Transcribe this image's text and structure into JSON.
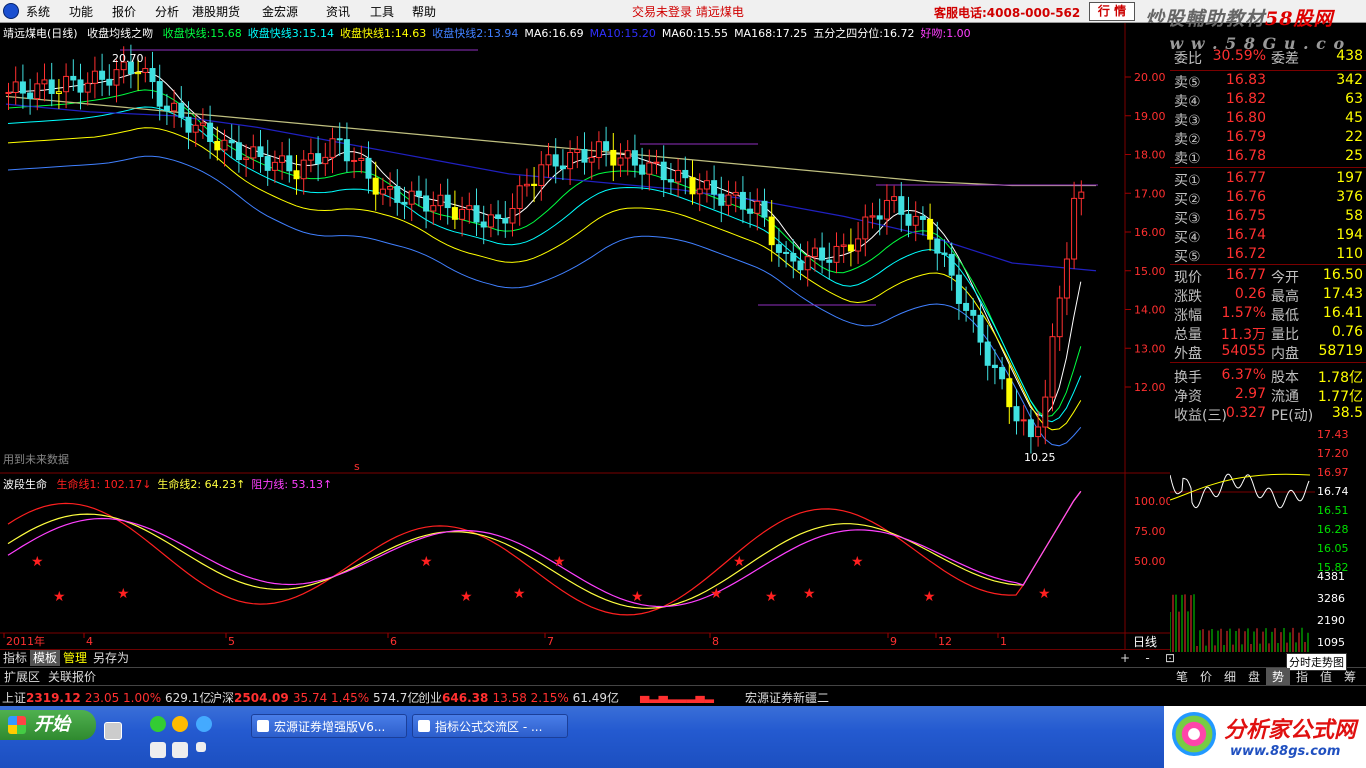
{
  "menu": {
    "items": [
      "系统",
      "功能",
      "报价",
      "分析",
      "港股期货",
      "金宏源",
      "资讯",
      "工具",
      "帮助"
    ],
    "notice": "交易未登录  靖远煤电",
    "phone": "客服电话:4008-000-562",
    "quote_button": "行 情",
    "watermark1": "炒股輔助教材",
    "watermark1_site": "58股网",
    "watermark2": "w w w . 5 8 G u . c o m"
  },
  "main_chart": {
    "title": "靖远煤电(日线)",
    "indicator": "收盘均线之吻",
    "lines": [
      {
        "label": "收盘快线:",
        "value": "15.68",
        "color": "#00ff40"
      },
      {
        "label": "收盘快线3:",
        "value": "15.14",
        "color": "#00ffff"
      },
      {
        "label": "收盘快线1:",
        "value": "14.63",
        "color": "#ffff00"
      },
      {
        "label": "收盘快线2:",
        "value": "13.94",
        "color": "#4080ff"
      },
      {
        "label": "MA6:",
        "value": "16.69",
        "color": "#ffffff"
      },
      {
        "label": "MA10:",
        "value": "15.20",
        "color": "#3030ff"
      },
      {
        "label": "MA60:",
        "value": "15.55",
        "color": "#ffffff"
      },
      {
        "label": "MA168:",
        "value": "17.25",
        "color": "#ffffff"
      },
      {
        "label": "五分之四分位:",
        "value": "16.72",
        "color": "#ffffff"
      },
      {
        "label": "好吻:",
        "value": "1.00",
        "color": "#ff40ff"
      }
    ],
    "high_label": "20.70",
    "low_label": "10.25",
    "future_data": "用到未来数据",
    "marker_s": "s",
    "y_axis": [
      "20.00",
      "19.00",
      "18.00",
      "17.00",
      "16.00",
      "15.00",
      "14.00",
      "13.00",
      "12.00"
    ]
  },
  "sub_chart": {
    "title": "波段生命",
    "lines": [
      {
        "label": "生命线1:",
        "value": "102.17",
        "arrow": "↓",
        "color": "#ff2020"
      },
      {
        "label": "生命线2:",
        "value": "64.23",
        "arrow": "↑",
        "color": "#ffff40"
      },
      {
        "label": "阻力线:",
        "value": "53.13",
        "arrow": "↑",
        "color": "#ff40ff"
      }
    ],
    "y_axis": [
      "100.00",
      "75.00",
      "50.00"
    ]
  },
  "x_axis": {
    "labels": [
      "2011年",
      "4",
      "5",
      "6",
      "7",
      "8",
      "9",
      "12",
      "1"
    ]
  },
  "bottom_tabs": [
    "指标",
    "模板",
    "管理",
    "另存为"
  ],
  "day_label": "日线",
  "zoom": [
    "+",
    "-",
    "⊡"
  ],
  "ext_tabs": [
    "扩展区",
    "关联报价"
  ],
  "indexes": [
    {
      "name": "上证",
      "value": "2319.12",
      "chg": "23.05",
      "pct": "1.00%",
      "amt": "629.1亿"
    },
    {
      "name": "沪深",
      "value": "2504.09",
      "chg": "35.74",
      "pct": "1.45%",
      "amt": "574.7亿"
    },
    {
      "name": "创业",
      "value": "646.38",
      "chg": "13.58",
      "pct": "2.15%",
      "amt": "61.49亿"
    }
  ],
  "broker": "宏源证券新疆二",
  "quote": {
    "top_row": {
      "lab": "委比",
      "v1": "30.59%",
      "lab2": "委差",
      "v2": "438"
    },
    "sells": [
      {
        "lab": "卖⑤",
        "price": "16.83",
        "vol": "342"
      },
      {
        "lab": "卖④",
        "price": "16.82",
        "vol": "63"
      },
      {
        "lab": "卖③",
        "price": "16.80",
        "vol": "45"
      },
      {
        "lab": "卖②",
        "price": "16.79",
        "vol": "22"
      },
      {
        "lab": "卖①",
        "price": "16.78",
        "vol": "25"
      }
    ],
    "buys": [
      {
        "lab": "买①",
        "price": "16.77",
        "vol": "197"
      },
      {
        "lab": "买②",
        "price": "16.76",
        "vol": "376"
      },
      {
        "lab": "买③",
        "price": "16.75",
        "vol": "58"
      },
      {
        "lab": "买④",
        "price": "16.74",
        "vol": "194"
      },
      {
        "lab": "买⑤",
        "price": "16.72",
        "vol": "110"
      }
    ],
    "stats": [
      {
        "l1": "现价",
        "v1": "16.77",
        "l2": "今开",
        "v2": "16.50"
      },
      {
        "l1": "涨跌",
        "v1": "0.26",
        "l2": "最高",
        "v2": "17.43"
      },
      {
        "l1": "涨幅",
        "v1": "1.57%",
        "l2": "最低",
        "v2": "16.41"
      },
      {
        "l1": "总量",
        "v1": "11.3万",
        "l2": "量比",
        "v2": "0.76"
      },
      {
        "l1": "外盘",
        "v1": "54055",
        "l2": "内盘",
        "v2": "58719"
      },
      {
        "l1": "换手",
        "v1": "6.37%",
        "l2": "股本",
        "v2": "1.78亿"
      },
      {
        "l1": "净资",
        "v1": "2.97",
        "l2": "流通",
        "v2": "1.77亿"
      },
      {
        "l1": "收益(三)",
        "v1": "0.327",
        "l2": "PE(动)",
        "v2": "38.5"
      }
    ]
  },
  "mini_chart": {
    "labels": [
      "17.43",
      "17.20",
      "16.97",
      "16.74",
      "16.51",
      "16.28",
      "16.05",
      "15.82",
      "4381",
      "3286",
      "2190",
      "1095"
    ]
  },
  "fenshi_label": "分时走势图",
  "right_tabs": [
    "笔",
    "价",
    "细",
    "盘",
    "势",
    "指",
    "值",
    "筹"
  ],
  "taskbar": {
    "start": "开始",
    "windows": [
      "宏源证券增强版V6...",
      "指标公式交流区 - ..."
    ],
    "brand": "分析家公式网",
    "brand_url": "www.88gs.com"
  }
}
